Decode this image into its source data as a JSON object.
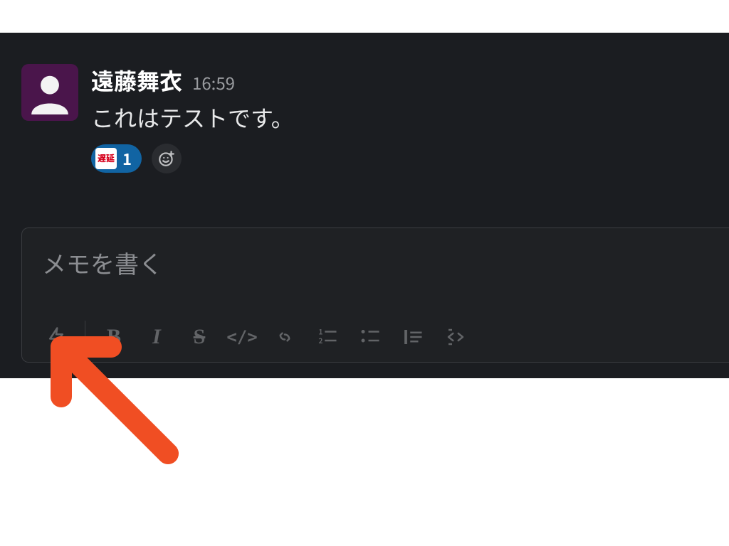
{
  "message": {
    "author": "遠藤舞衣",
    "time": "16:59",
    "text": "これはテストです。"
  },
  "reactions": {
    "count": "1",
    "emoji_label": "遅延"
  },
  "composer": {
    "placeholder": "メモを書く"
  },
  "toolbar": {
    "shortcuts": "shortcuts",
    "bold": "B",
    "italic": "I",
    "strike": "S",
    "code_inline": "</>",
    "link": "link",
    "ordered_list": "ordered-list",
    "unordered_list": "unordered-list",
    "blockquote": "blockquote",
    "code_block": "code-block"
  }
}
